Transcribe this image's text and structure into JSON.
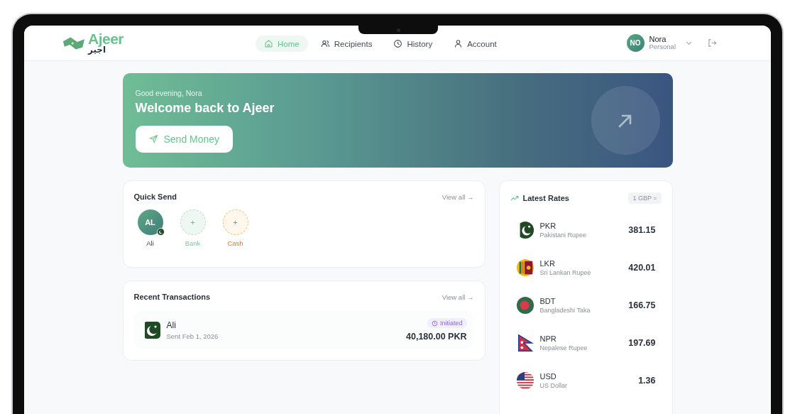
{
  "brand": {
    "latin": "Ajeer",
    "arabic": "اجير"
  },
  "nav": [
    {
      "label": "Home",
      "selected": true
    },
    {
      "label": "Recipients",
      "selected": false
    },
    {
      "label": "History",
      "selected": false
    },
    {
      "label": "Account",
      "selected": false
    }
  ],
  "user": {
    "initials": "NO",
    "name": "Nora",
    "plan": "Personal"
  },
  "hero": {
    "greeting": "Good evening, Nora",
    "title": "Welcome back to Ajeer",
    "button": "Send Money"
  },
  "quick_send": {
    "title": "Quick Send",
    "view_all": "View all →",
    "items": [
      {
        "kind": "contact",
        "avatar": "AL",
        "label": "Ali"
      },
      {
        "kind": "bank",
        "avatar": "+",
        "label": "Bank"
      },
      {
        "kind": "cash",
        "avatar": "+",
        "label": "Cash"
      }
    ]
  },
  "recent": {
    "title": "Recent Transactions",
    "view_all": "View all →",
    "items": [
      {
        "name": "Ali",
        "date": "Sent Feb 1, 2026",
        "status": "Initiated",
        "amount": "40,180.00 PKR"
      }
    ]
  },
  "rates": {
    "title": "Latest Rates",
    "base": "1 GBP =",
    "items": [
      {
        "code": "PKR",
        "name": "Pakistani Rupee",
        "rate": "381.15"
      },
      {
        "code": "LKR",
        "name": "Sri Lankan Rupee",
        "rate": "420.01"
      },
      {
        "code": "BDT",
        "name": "Bangladeshi Taka",
        "rate": "166.75"
      },
      {
        "code": "NPR",
        "name": "Nepalese Rupee",
        "rate": "197.69"
      },
      {
        "code": "USD",
        "name": "US Dollar",
        "rate": "1.36"
      }
    ]
  }
}
